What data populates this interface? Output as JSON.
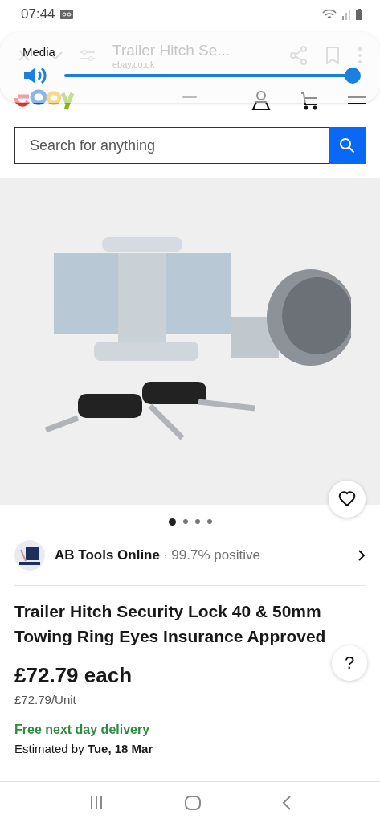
{
  "status_bar": {
    "time": "07:44"
  },
  "browser_toolbar": {
    "title": "Trailer Hitch Se...",
    "url": "ebay.co.uk"
  },
  "volume_panel": {
    "label": "Media",
    "level": 1.0
  },
  "search": {
    "placeholder": "Search for anything"
  },
  "gallery": {
    "dots": [
      {
        "selected": true
      },
      {
        "selected": false
      },
      {
        "selected": false
      },
      {
        "selected": false
      }
    ]
  },
  "seller": {
    "name": "AB Tools Online",
    "feedback": "· 99.7% positive"
  },
  "product": {
    "title": "Trailer Hitch Security Lock 40 & 50mm Towing Ring Eyes Insurance Approved",
    "price": "£72.79 each",
    "unit_price": "£72.79/Unit",
    "delivery": "Free next day delivery",
    "estimate": "Estimated by **Tue, 18 Mar**"
  },
  "help_button": "?"
}
